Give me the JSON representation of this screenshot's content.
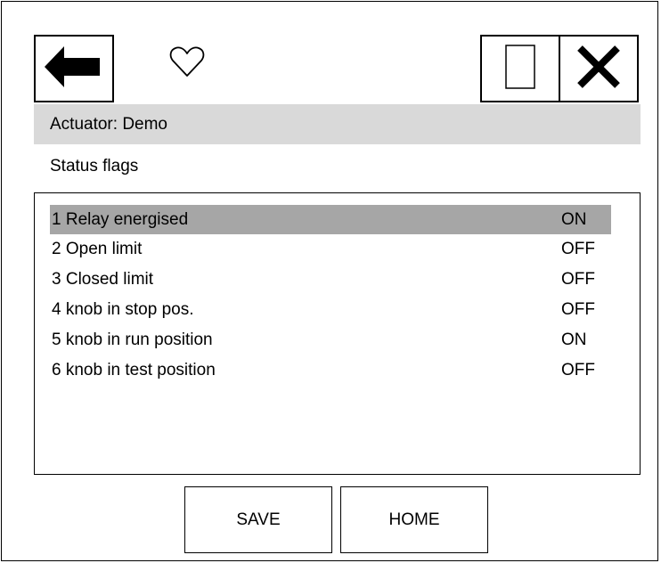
{
  "header": {
    "back_icon": "arrow-left-icon",
    "favorite_icon": "heart-outline-icon",
    "window_icon": "window-rectangle-icon",
    "close_icon": "close-x-icon"
  },
  "titlebar": {
    "title": "Actuator: Demo"
  },
  "section": {
    "label": "Status flags"
  },
  "flags": [
    {
      "name": "1 Relay energised",
      "value": "ON"
    },
    {
      "name": "2 Open limit",
      "value": "OFF"
    },
    {
      "name": "3 Closed limit",
      "value": "OFF"
    },
    {
      "name": "4 knob in stop pos.",
      "value": "OFF"
    },
    {
      "name": "5 knob in run position",
      "value": "ON"
    },
    {
      "name": "6 knob in test position",
      "value": "OFF"
    }
  ],
  "footer": {
    "save_label": "SAVE",
    "home_label": "HOME"
  },
  "colors": {
    "titlebar_bg": "#d9d9d9",
    "selected_row_bg": "#a6a6a6"
  }
}
